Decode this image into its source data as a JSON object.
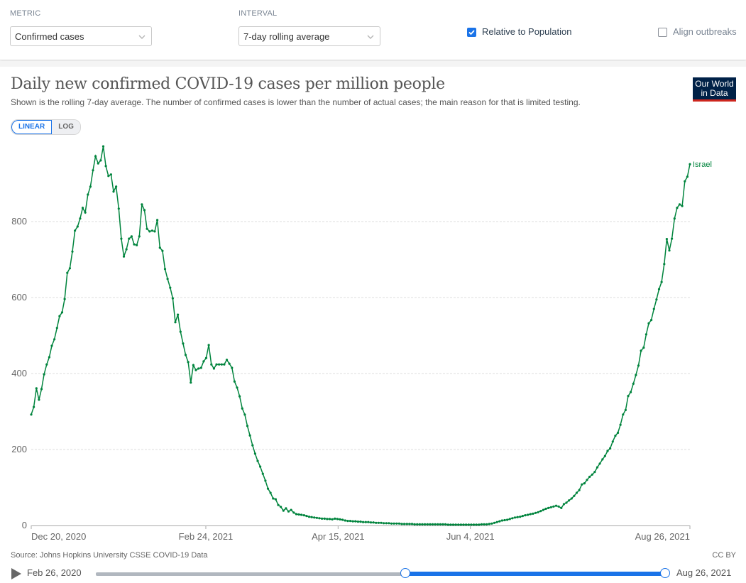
{
  "controls": {
    "metric_label": "METRIC",
    "metric_value": "Confirmed cases",
    "interval_label": "INTERVAL",
    "interval_value": "7-day rolling average",
    "relative_label": "Relative to Population",
    "relative_checked": true,
    "align_label": "Align outbreaks",
    "align_checked": false
  },
  "header": {
    "title": "Daily new confirmed COVID-19 cases per million people",
    "subtitle": "Shown is the rolling 7-day average. The number of confirmed cases is lower than the number of actual cases; the main reason for that is limited testing.",
    "logo_line1": "Our World",
    "logo_line2": "in Data",
    "scale_linear": "LINEAR",
    "scale_log": "LOG",
    "active_scale": "linear"
  },
  "footer": {
    "source": "Source: Johns Hopkins University CSSE COVID-19 Data",
    "license": "CC BY"
  },
  "timeline": {
    "start_label": "Feb 26, 2020",
    "end_label": "Aug 26, 2021",
    "selection_start_fraction": 0.544,
    "selection_end_fraction": 1.0
  },
  "colors": {
    "series": "#00843d",
    "accent": "#1a73e8",
    "logo_bg": "#002147",
    "logo_bar": "#ce261e"
  },
  "chart_data": {
    "type": "line",
    "title": "Daily new confirmed COVID-19 cases per million people",
    "xlabel": "",
    "ylabel": "",
    "x_start": "2020-12-20",
    "x_end": "2021-08-26",
    "x_ticks": [
      "Dec 20, 2020",
      "Feb 24, 2021",
      "Apr 15, 2021",
      "Jun 4, 2021",
      "Aug 26, 2021"
    ],
    "x_tick_days": [
      0,
      66,
      116,
      166,
      249
    ],
    "y_ticks": [
      0,
      200,
      400,
      600,
      800
    ],
    "ylim": [
      0,
      1000
    ],
    "grid": true,
    "legend": "end-label",
    "series": [
      {
        "name": "Israel",
        "values": [
          292,
          312,
          361,
          331,
          359,
          398,
          424,
          443,
          473,
          490,
          520,
          551,
          561,
          596,
          665,
          677,
          721,
          776,
          787,
          808,
          836,
          824,
          871,
          892,
          935,
          972,
          953,
          961,
          998,
          946,
          920,
          924,
          879,
          892,
          834,
          755,
          708,
          727,
          755,
          761,
          740,
          738,
          761,
          845,
          830,
          781,
          774,
          776,
          774,
          804,
          731,
          723,
          675,
          649,
          626,
          598,
          535,
          555,
          510,
          479,
          449,
          430,
          376,
          422,
          409,
          413,
          415,
          432,
          441,
          475,
          424,
          413,
          424,
          424,
          424,
          424,
          436,
          426,
          415,
          379,
          363,
          340,
          308,
          292,
          262,
          237,
          211,
          189,
          170,
          155,
          136,
          118,
          97,
          86,
          71,
          69,
          54,
          49,
          39,
          45,
          37,
          41,
          34,
          30,
          29,
          28,
          27,
          25,
          23,
          22,
          21,
          20,
          19,
          18,
          18,
          17,
          17,
          16,
          18,
          17,
          16,
          15,
          13,
          12,
          12,
          11,
          11,
          10,
          10,
          9,
          9,
          9,
          8,
          8,
          7,
          7,
          7,
          6,
          6,
          6,
          5,
          5,
          5,
          5,
          4,
          4,
          4,
          4,
          4,
          3,
          3,
          3,
          3,
          3,
          3,
          3,
          3,
          3,
          3,
          3,
          3,
          3,
          2,
          2,
          2,
          2,
          2,
          2,
          2,
          2,
          2,
          2,
          2,
          2,
          2,
          3,
          3,
          3,
          4,
          5,
          7,
          9,
          11,
          13,
          14,
          15,
          17,
          19,
          21,
          22,
          23,
          25,
          27,
          28,
          30,
          31,
          33,
          35,
          38,
          41,
          44,
          46,
          48,
          50,
          52,
          50,
          46,
          56,
          60,
          66,
          71,
          78,
          86,
          93,
          108,
          111,
          120,
          128,
          134,
          141,
          153,
          163,
          174,
          183,
          196,
          203,
          221,
          236,
          244,
          265,
          292,
          304,
          341,
          351,
          373,
          396,
          421,
          460,
          468,
          503,
          532,
          541,
          570,
          595,
          622,
          641,
          688,
          754,
          724,
          755,
          808,
          836,
          845,
          841,
          906,
          918,
          951
        ]
      }
    ]
  }
}
